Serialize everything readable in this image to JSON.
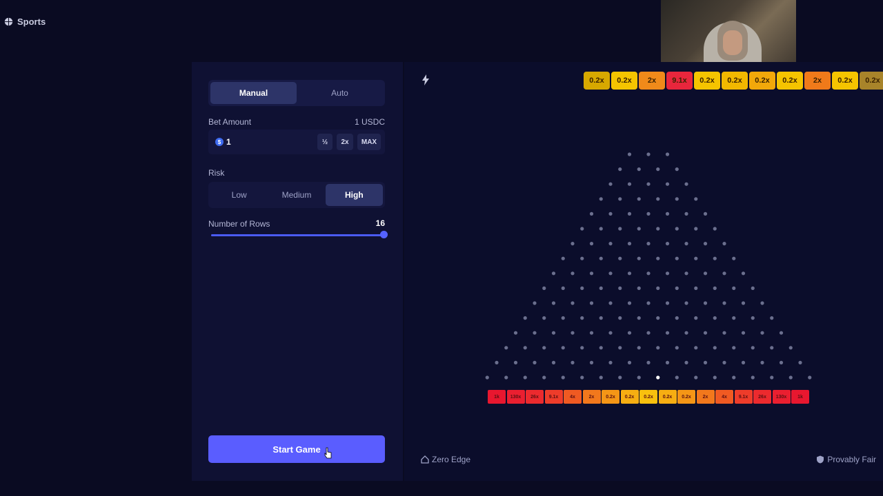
{
  "nav": {
    "sports_label": "Sports"
  },
  "controls": {
    "tabs": [
      {
        "label": "Manual",
        "active": true
      },
      {
        "label": "Auto",
        "active": false
      }
    ],
    "bet_amount_label": "Bet Amount",
    "bet_amount_value_display": "1 USDC",
    "bet_input_value": "1",
    "coin_symbol": "$",
    "half_label": "½",
    "double_label": "2x",
    "max_label": "MAX",
    "risk_label": "Risk",
    "risk_options": [
      {
        "label": "Low",
        "active": false
      },
      {
        "label": "Medium",
        "active": false
      },
      {
        "label": "High",
        "active": true
      }
    ],
    "rows_label": "Number of Rows",
    "rows_value": "16",
    "rows_slider_fraction": 1.0,
    "start_button": "Start Game"
  },
  "board": {
    "history": [
      {
        "label": "0.2x",
        "color": "#d7a800"
      },
      {
        "label": "0.2x",
        "color": "#f5c400"
      },
      {
        "label": "2x",
        "color": "#f08a1a"
      },
      {
        "label": "9.1x",
        "color": "#e8263c"
      },
      {
        "label": "0.2x",
        "color": "#f5c400"
      },
      {
        "label": "0.2x",
        "color": "#f2b800"
      },
      {
        "label": "0.2x",
        "color": "#f2a80a"
      },
      {
        "label": "0.2x",
        "color": "#f5c400"
      },
      {
        "label": "2x",
        "color": "#f07a1a"
      },
      {
        "label": "0.2x",
        "color": "#f5c400"
      },
      {
        "label": "0.2x",
        "color": "#a8842a"
      }
    ],
    "rows": 16,
    "buckets": [
      {
        "label": "1k",
        "color": "#e8172f"
      },
      {
        "label": "130x",
        "color": "#ea1f30"
      },
      {
        "label": "26x",
        "color": "#ec2a2e"
      },
      {
        "label": "9.1x",
        "color": "#ee3c2a"
      },
      {
        "label": "4x",
        "color": "#f05a22"
      },
      {
        "label": "2x",
        "color": "#f2781c"
      },
      {
        "label": "0.2x",
        "color": "#f59616"
      },
      {
        "label": "0.2x",
        "color": "#f7ae12"
      },
      {
        "label": "0.2x",
        "color": "#f9c00e"
      },
      {
        "label": "0.2x",
        "color": "#f7ae12"
      },
      {
        "label": "0.2x",
        "color": "#f59616"
      },
      {
        "label": "2x",
        "color": "#f2781c"
      },
      {
        "label": "4x",
        "color": "#f05a22"
      },
      {
        "label": "9.1x",
        "color": "#ee3c2a"
      },
      {
        "label": "26x",
        "color": "#ec2a2e"
      },
      {
        "label": "130x",
        "color": "#ea1f30"
      },
      {
        "label": "1k",
        "color": "#e8172f"
      }
    ],
    "zero_edge_label": "Zero Edge",
    "provably_fair_label": "Provably Fair"
  }
}
